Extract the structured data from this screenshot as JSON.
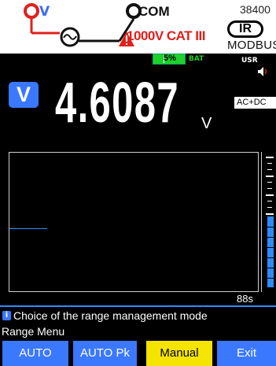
{
  "header": {
    "v_terminal_label": "V",
    "com_label": "COM",
    "cat_rating": "1000V CAT III",
    "model": "38400",
    "ir_label": "IR",
    "protocol": "MODBUS"
  },
  "status": {
    "battery_percent": "5%",
    "battery_level": 0.05,
    "battery_label": "BAT",
    "user_label": "USR"
  },
  "measurement": {
    "mode": "V",
    "value": "4.6087",
    "unit": "V",
    "coupling": "AC+DC"
  },
  "graph": {
    "time_label": "88s"
  },
  "help": {
    "text": "Choice of the range management mode",
    "info_icon_glyph": "i"
  },
  "menu": {
    "title": "Range Menu",
    "keys": {
      "auto": "AUTO",
      "auto_pk": "AUTO Pk",
      "manual": "Manual",
      "exit": "Exit"
    }
  },
  "colors": {
    "accent_blue": "#3a78ff",
    "selected_yellow": "#f5e400",
    "battery_green": "#1fd12a",
    "warning_red": "#e0201c"
  },
  "icons": [
    "v-terminal-icon",
    "com-terminal-icon",
    "ac-source-icon",
    "warning-icon",
    "speaker-icon",
    "info-icon"
  ]
}
